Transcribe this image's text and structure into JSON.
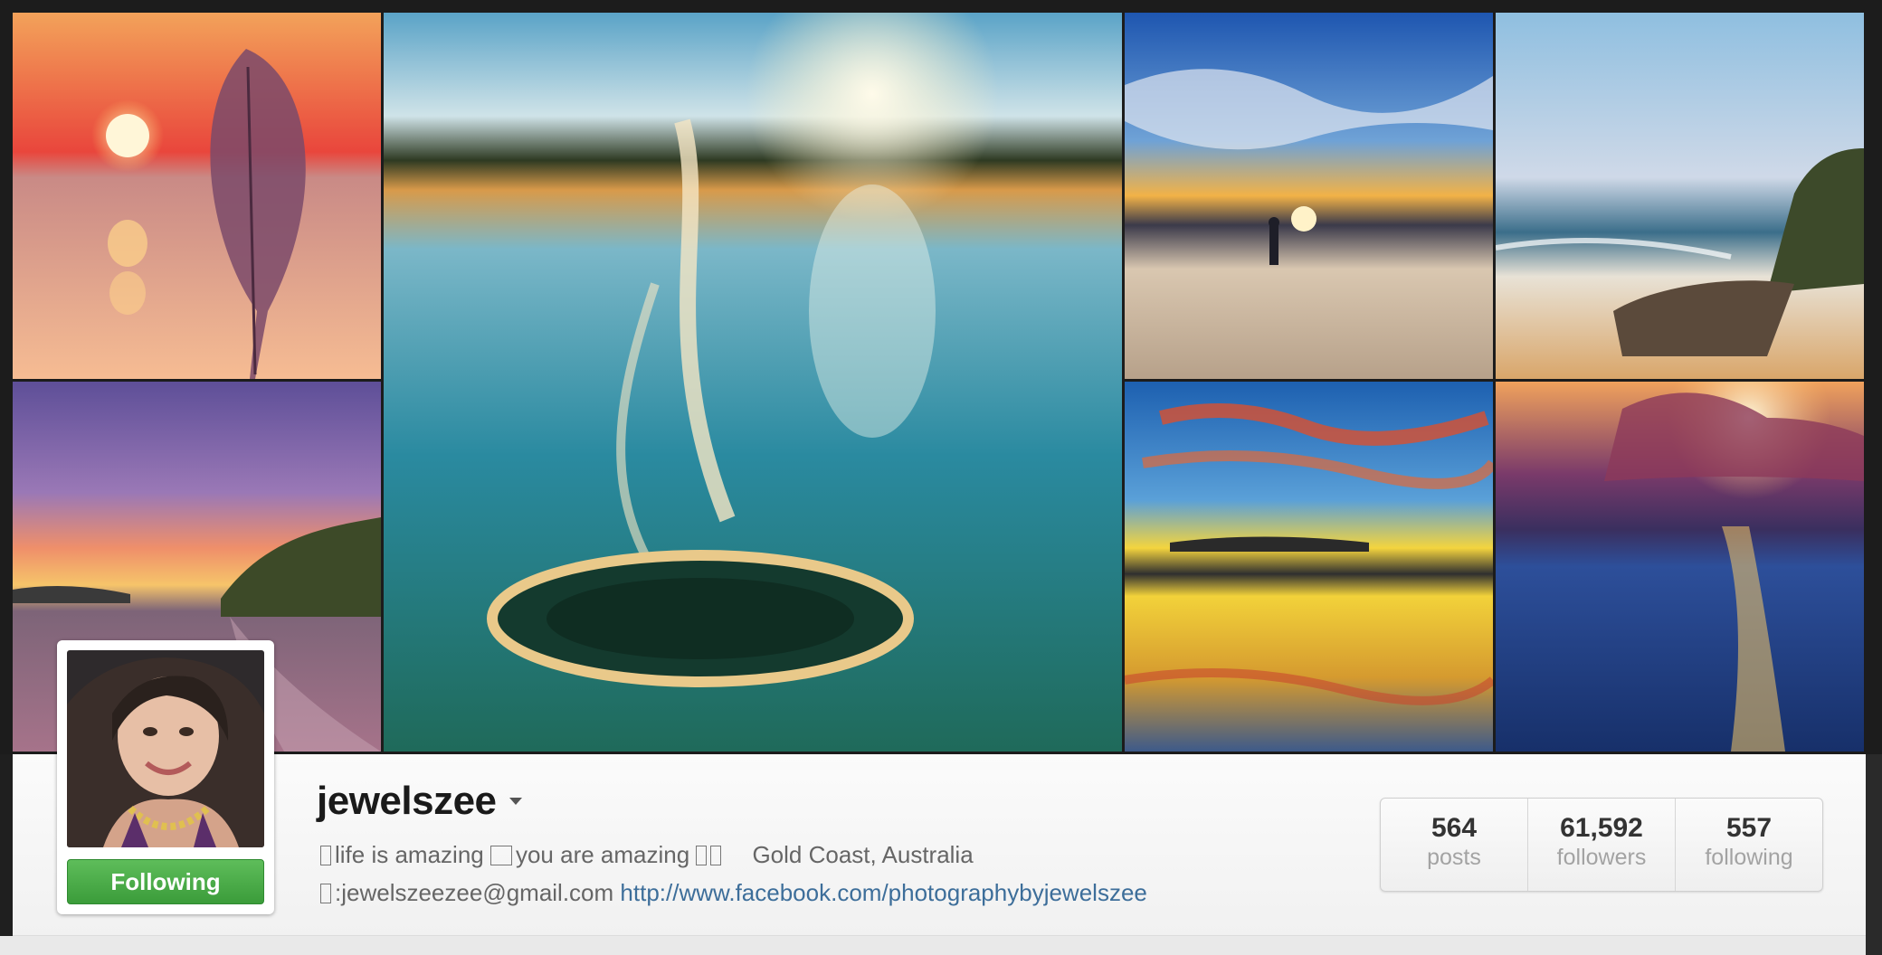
{
  "profile": {
    "username": "jewelszee",
    "follow_button_label": "Following",
    "bio": {
      "line1_part1": "life is amazing",
      "line1_part2": "you are amazing",
      "location": "Gold Coast, Australia",
      "email": ":jewelszeezee@gmail.com",
      "website": "http://www.facebook.com/photographybyjewelszee"
    }
  },
  "stats": [
    {
      "count": "564",
      "label": "posts"
    },
    {
      "count": "61,592",
      "label": "followers"
    },
    {
      "count": "557",
      "label": "following"
    }
  ],
  "mosaic": {
    "tiles": [
      {
        "name": "photo-sunset-feather",
        "colors": [
          "#f4b07a",
          "#e05b3e",
          "#f6c59a"
        ]
      },
      {
        "name": "photo-water-splash",
        "colors": [
          "#3c8fb3",
          "#1e5a66",
          "#f2d49a"
        ]
      },
      {
        "name": "photo-surfer-sunset",
        "colors": [
          "#2b63b8",
          "#f1a641",
          "#d7b08c"
        ]
      },
      {
        "name": "photo-rocky-beach",
        "colors": [
          "#7fb6d9",
          "#e0c48e",
          "#6a5a48"
        ]
      },
      {
        "name": "photo-purple-sky-beach",
        "colors": [
          "#6c5aa8",
          "#e87f5d",
          "#8f6a8a"
        ]
      },
      {
        "name": "photo-golden-reflection",
        "colors": [
          "#1e66b0",
          "#f2d03a",
          "#c9892b"
        ]
      },
      {
        "name": "photo-sun-rays-ocean",
        "colors": [
          "#3a2a6a",
          "#f2a657",
          "#1f3f8a"
        ]
      }
    ]
  }
}
